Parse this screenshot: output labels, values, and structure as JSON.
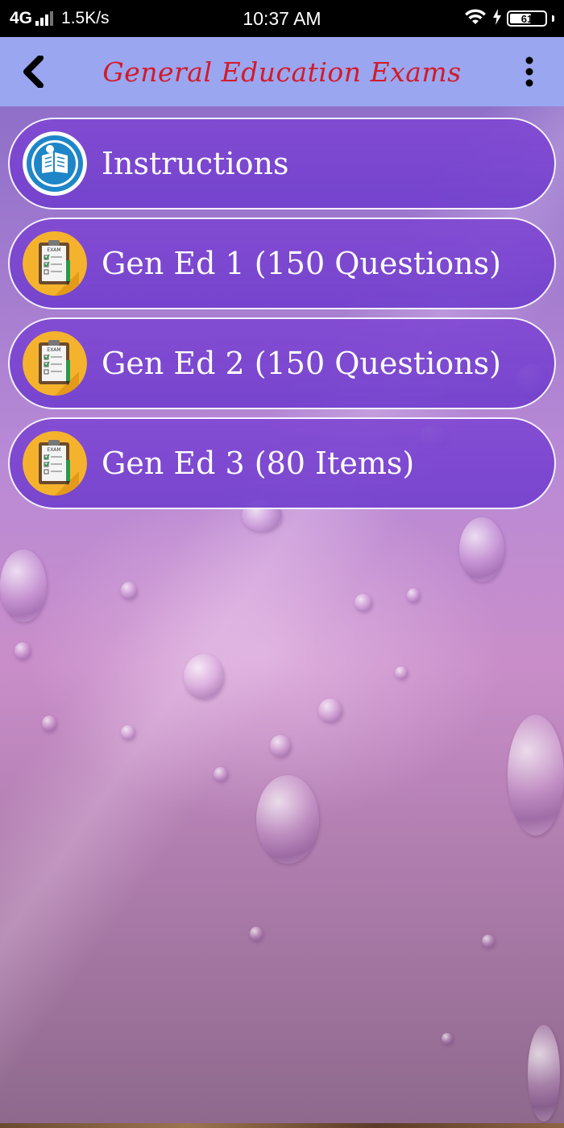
{
  "status_bar": {
    "network": "4G",
    "speed": "1.5K/s",
    "time": "10:37 AM",
    "battery": "61"
  },
  "app_bar": {
    "title": "General Education Exams",
    "title_color": "#d31a2a",
    "background_color": "#9aa6ef"
  },
  "menu": {
    "items": [
      {
        "label": "Instructions",
        "icon": "instructions-icon"
      },
      {
        "label": "Gen Ed 1 (150 Questions)",
        "icon": "exam-clipboard-icon"
      },
      {
        "label": "Gen Ed 2 (150 Questions)",
        "icon": "exam-clipboard-icon"
      },
      {
        "label": "Gen Ed 3 (80 Items)",
        "icon": "exam-clipboard-icon"
      }
    ],
    "item_color": "#7a44d0"
  }
}
